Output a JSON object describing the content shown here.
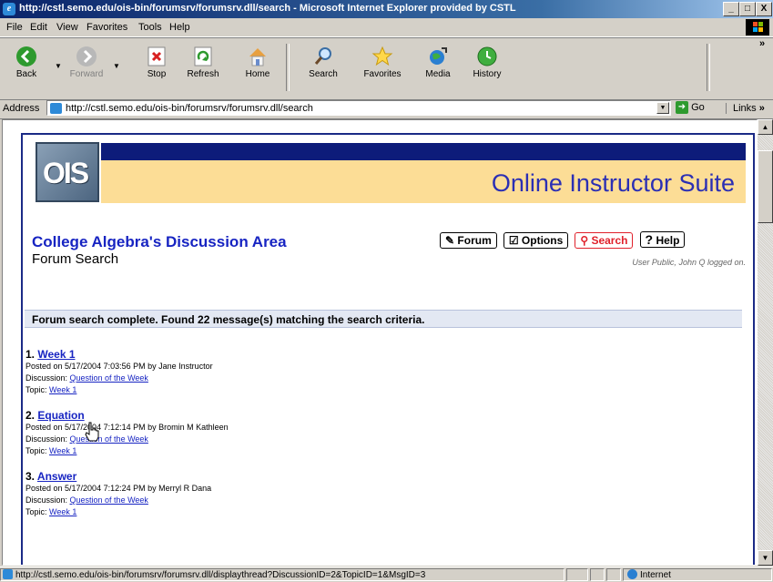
{
  "window": {
    "title": "http://cstl.semo.edu/ois-bin/forumsrv/forumsrv.dll/search - Microsoft Internet Explorer provided by CSTL",
    "minimize": "_",
    "maximize": "□",
    "close": "X"
  },
  "menu": [
    "File",
    "Edit",
    "View",
    "Favorites",
    "Tools",
    "Help"
  ],
  "toolbar": {
    "back": "Back",
    "forward": "Forward",
    "stop": "Stop",
    "refresh": "Refresh",
    "home": "Home",
    "search": "Search",
    "favorites": "Favorites",
    "media": "Media",
    "history": "History",
    "overflow": "»"
  },
  "address": {
    "label": "Address",
    "url": "http://cstl.semo.edu/ois-bin/forumsrv/forumsrv.dll/search",
    "go": "Go",
    "links": "Links",
    "links_overflow": "»"
  },
  "page": {
    "logo_text": "OIS",
    "suite_title": "Online Instructor Suite",
    "area_title": "College Algebra's Discussion Area",
    "sub_title": "Forum Search",
    "nav": {
      "forum": "Forum",
      "options": "Options",
      "search": "Search",
      "help": "Help"
    },
    "logged_in": "User Public, John Q logged on.",
    "summary": "Forum search complete. Found 22 message(s) matching the search criteria.",
    "results": [
      {
        "number": "1.",
        "title": "Week 1",
        "posted": "Posted on 5/17/2004 7:03:56 PM by Jane Instructor",
        "discussion_label": "Discussion:",
        "discussion": "Question of the Week",
        "topic_label": "Topic:",
        "topic": "Week 1"
      },
      {
        "number": "2.",
        "title": "Equation",
        "posted": "Posted on 5/17/2004 7:12:14 PM by Bromin M Kathleen",
        "discussion_label": "Discussion:",
        "discussion": "Question of the Week",
        "topic_label": "Topic:",
        "topic": "Week 1"
      },
      {
        "number": "3.",
        "title": "Answer",
        "posted": "Posted on 5/17/2004 7:12:24 PM by Merryl R Dana",
        "discussion_label": "Discussion:",
        "discussion": "Question of the Week",
        "topic_label": "Topic:",
        "topic": "Week 1"
      }
    ]
  },
  "status": {
    "text": "http://cstl.semo.edu/ois-bin/forumsrv/forumsrv.dll/displaythread?DiscussionID=2&TopicID=1&MsgID=3",
    "zone": "Internet"
  }
}
